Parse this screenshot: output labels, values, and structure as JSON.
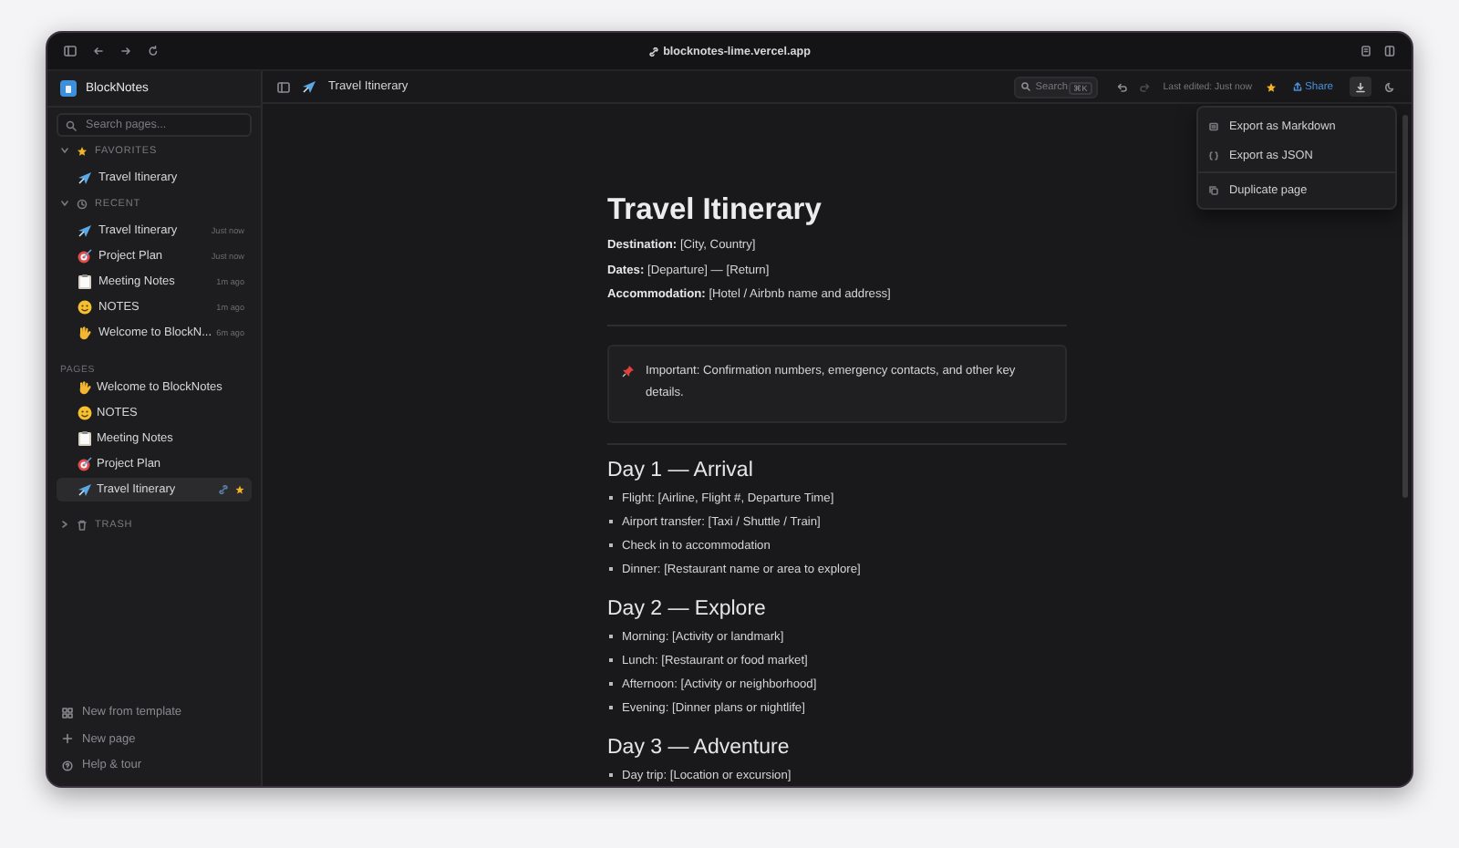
{
  "browser": {
    "url": "blocknotes-lime.vercel.app"
  },
  "sidebar": {
    "app_name": "BlockNotes",
    "search": {
      "placeholder": "Search pages..."
    },
    "favorites": {
      "label": "FAVORITES",
      "expanded": true,
      "items": [
        {
          "kind": "plane",
          "title": "Travel Itinerary"
        }
      ]
    },
    "recent": {
      "label": "RECENT",
      "expanded": true,
      "items": [
        {
          "kind": "plane",
          "title": "Travel Itinerary",
          "time": "Just now"
        },
        {
          "kind": "target",
          "title": "Project Plan",
          "time": "Just now"
        },
        {
          "kind": "clipboard",
          "title": "Meeting Notes",
          "time": "1m ago"
        },
        {
          "kind": "smiley",
          "title": "NOTES",
          "time": "1m ago"
        },
        {
          "kind": "hand",
          "title": "Welcome to BlockN...",
          "time": "6m ago"
        }
      ]
    },
    "pages": {
      "label": "PAGES",
      "items": [
        {
          "kind": "hand",
          "title": "Welcome to BlockNotes",
          "selected": false,
          "starred": false
        },
        {
          "kind": "smiley",
          "title": "NOTES",
          "selected": false,
          "starred": false
        },
        {
          "kind": "clipboard",
          "title": "Meeting Notes",
          "selected": false,
          "starred": false
        },
        {
          "kind": "target",
          "title": "Project Plan",
          "selected": false,
          "starred": false
        },
        {
          "kind": "plane",
          "title": "Travel Itinerary",
          "selected": true,
          "starred": true
        }
      ]
    },
    "trash": {
      "label": "TRASH",
      "expanded": false
    },
    "footer": [
      {
        "kind": "template",
        "label": "New from template"
      },
      {
        "kind": "plus",
        "label": "New page"
      },
      {
        "kind": "help",
        "label": "Help & tour"
      }
    ]
  },
  "topbar": {
    "page": {
      "kind": "plane",
      "title": "Travel Itinerary"
    },
    "search": {
      "placeholder": "Search",
      "shortcut": "⌘K"
    },
    "last_edited": "Last edited: Just now",
    "starred": true,
    "share": "Share",
    "menu_open": true
  },
  "menu": [
    {
      "kind": "markdown",
      "label": "Export as Markdown"
    },
    {
      "kind": "json",
      "label": "Export as JSON"
    },
    {
      "kind": "divider"
    },
    {
      "kind": "duplicate",
      "label": "Duplicate page"
    }
  ],
  "document": {
    "title": "Travel Itinerary",
    "properties": [
      "**Destination:** [City, Country]",
      "**Dates:** [Departure] — [Return]",
      "**Accommodation:** [Hotel / Airbnb name and address]"
    ],
    "callout": "Important: Confirmation numbers, emergency contacts, and other key details.",
    "sections": [
      {
        "heading": "Day 1 — Arrival",
        "items": [
          "Flight: [Airline, Flight #, Departure Time]",
          "Airport transfer: [Taxi / Shuttle / Train]",
          "Check in to accommodation",
          "Dinner: [Restaurant name or area to explore]"
        ]
      },
      {
        "heading": "Day 2 — Explore",
        "items": [
          "Morning: [Activity or landmark]",
          "Lunch: [Restaurant or food market]",
          "Afternoon: [Activity or neighborhood]",
          "Evening: [Dinner plans or nightlife]"
        ]
      },
      {
        "heading": "Day 3 — Adventure",
        "items": [
          "Day trip: [Location or excursion]"
        ]
      }
    ]
  }
}
